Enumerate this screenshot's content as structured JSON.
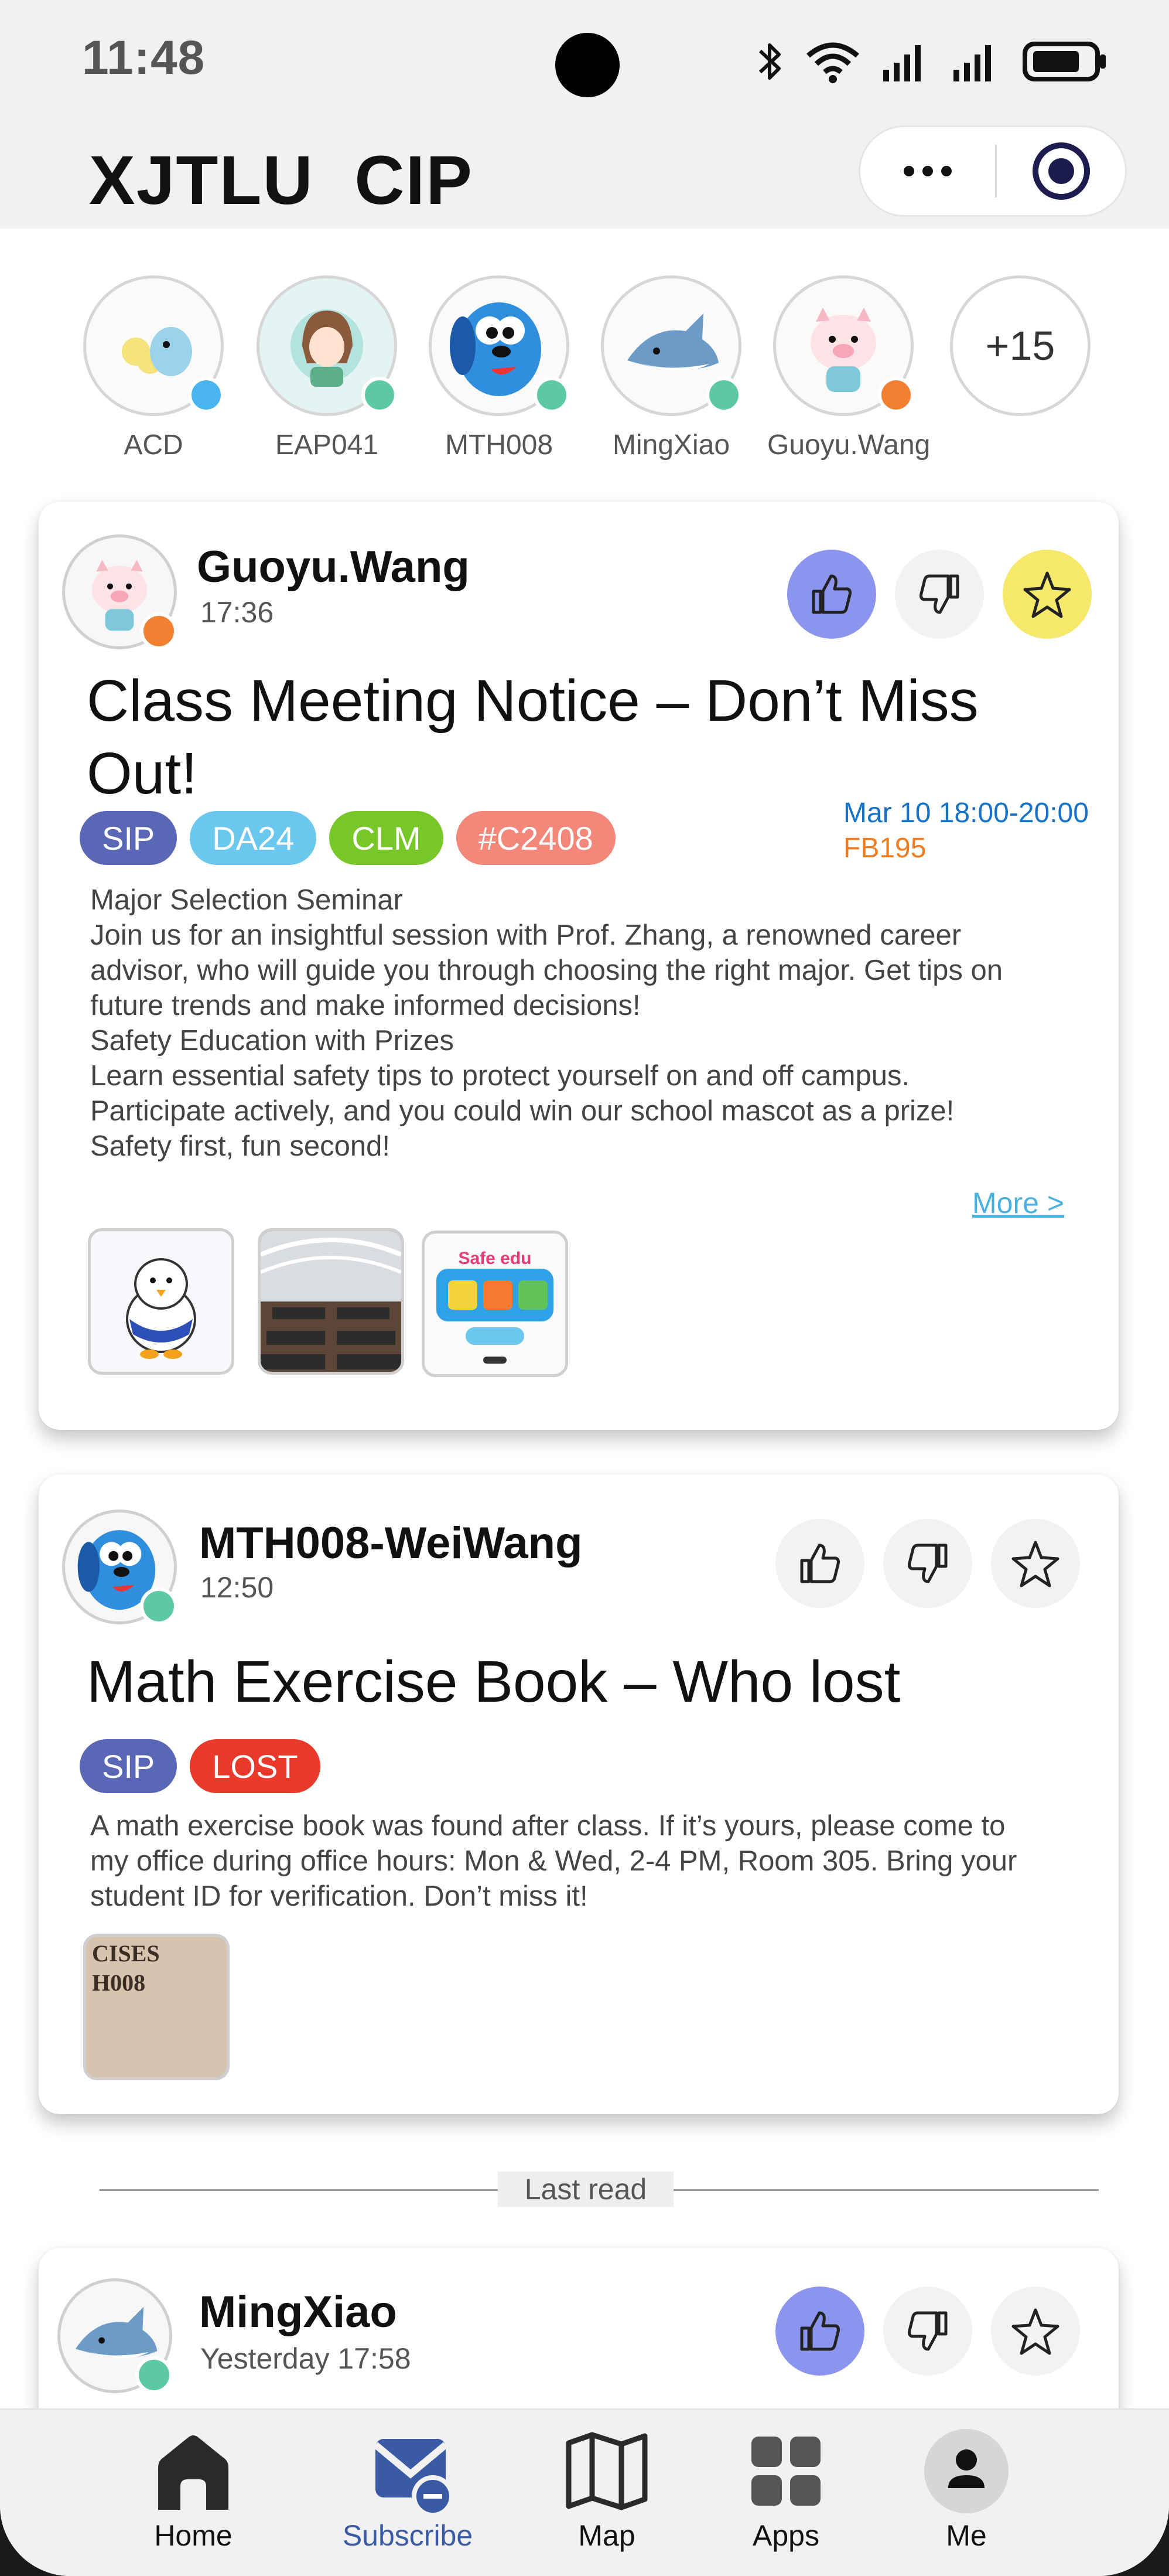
{
  "status_bar": {
    "time": "11:48"
  },
  "header": {
    "title": "XJTLU  CIP"
  },
  "stories": [
    {
      "name": "ACD",
      "badge_color": "#49b5f0",
      "icon": "penguin-avatar"
    },
    {
      "name": "EAP041",
      "badge_color": "#5cc9a2",
      "icon": "girl-avatar"
    },
    {
      "name": "MTH008",
      "badge_color": "#5cc9a2",
      "icon": "blue-dog-avatar"
    },
    {
      "name": "MingXiao",
      "badge_color": "#5cc9a2",
      "icon": "shark-avatar"
    },
    {
      "name": "Guoyu.Wang",
      "badge_color": "#f28030",
      "icon": "pig-avatar"
    },
    {
      "name": "",
      "more_count": "+15"
    }
  ],
  "posts": [
    {
      "author": "Guoyu.Wang",
      "time": "17:36",
      "badge_color": "#f28030",
      "liked": true,
      "starred": true,
      "title_line1": "Class Meeting Notice – Don’t Miss",
      "title_line2": "Out!",
      "tags": [
        {
          "label": "SIP",
          "color": "#5a67b6"
        },
        {
          "label": "DA24",
          "color": "#6cc7ee"
        },
        {
          "label": "CLM",
          "color": "#78c728"
        },
        {
          "label": "#C2408",
          "color": "#f2877a"
        }
      ],
      "event_time": "Mar 10 18:00-20:00",
      "event_place": "FB195",
      "body_lines": [
        "Major Selection Seminar",
        "Join us for an insightful session with Prof. Zhang, a renowned career",
        "advisor, who will guide you through choosing the right major. Get tips on",
        "future trends and make informed decisions!",
        "",
        "Safety Education with Prizes",
        "Learn essential safety tips to protect yourself on and off campus.",
        "Participate actively, and you could win our school mascot as a prize!",
        "Safety first, fun second!"
      ],
      "more_link": "More >",
      "safe_edu_label": "Safe edu"
    },
    {
      "author": "MTH008-WeiWang",
      "time": "12:50",
      "badge_color": "#5cc9a2",
      "liked": false,
      "starred": false,
      "title": "Math Exercise Book – Who lost",
      "tags": [
        {
          "label": "SIP",
          "color": "#5a67b6"
        },
        {
          "label": "LOST",
          "color": "#e8392b"
        }
      ],
      "body_lines": [
        "A math exercise book was found after class. If it’s yours, please come to",
        "my office during office hours: Mon & Wed, 2-4 PM, Room 305. Bring your",
        "student ID for verification. Don’t miss it!"
      ],
      "thumb_text": "CISES\nH008"
    },
    {
      "author": "MingXiao",
      "time": "Yesterday 17:58",
      "badge_color": "#5cc9a2",
      "liked": true,
      "starred": false
    }
  ],
  "last_read_label": "Last read",
  "tabbar": [
    {
      "label": "Home",
      "icon": "home-icon"
    },
    {
      "label": "Subscribe",
      "icon": "subscribe-icon",
      "active": true
    },
    {
      "label": "Map",
      "icon": "map-icon"
    },
    {
      "label": "Apps",
      "icon": "apps-icon"
    },
    {
      "label": "Me",
      "icon": "profile-icon"
    }
  ]
}
